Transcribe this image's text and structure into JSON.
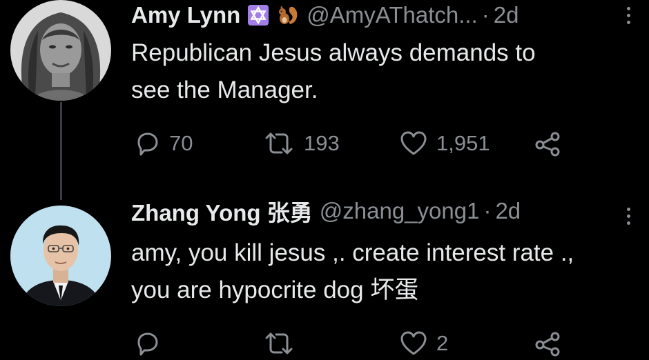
{
  "tweets": [
    {
      "display_name": "Amy Lynn",
      "handle": "@AmyAThatch...",
      "separator": "·",
      "time": "2d",
      "text": "Republican Jesus always demands to\nsee the Manager.",
      "replies": "70",
      "retweets": "193",
      "likes": "1,951"
    },
    {
      "display_name": "Zhang Yong 张勇",
      "handle": "@zhang_yong1",
      "separator": "·",
      "time": "2d",
      "text": "amy, you kill jesus ,. create interest rate .,\nyou are hypocrite dog 坏蛋",
      "replies": "",
      "retweets": "",
      "likes": "2"
    }
  ],
  "icons": {
    "badges": [
      "star-of-david-icon",
      "squirrel-icon"
    ],
    "actions": [
      "reply-icon",
      "retweet-icon",
      "like-icon",
      "share-icon"
    ],
    "menu": "more-options-icon"
  },
  "colors": {
    "background": "#000000",
    "text": "#e7e9ea",
    "secondary": "#8b8f94",
    "badge_purple": "#a27ee8"
  }
}
